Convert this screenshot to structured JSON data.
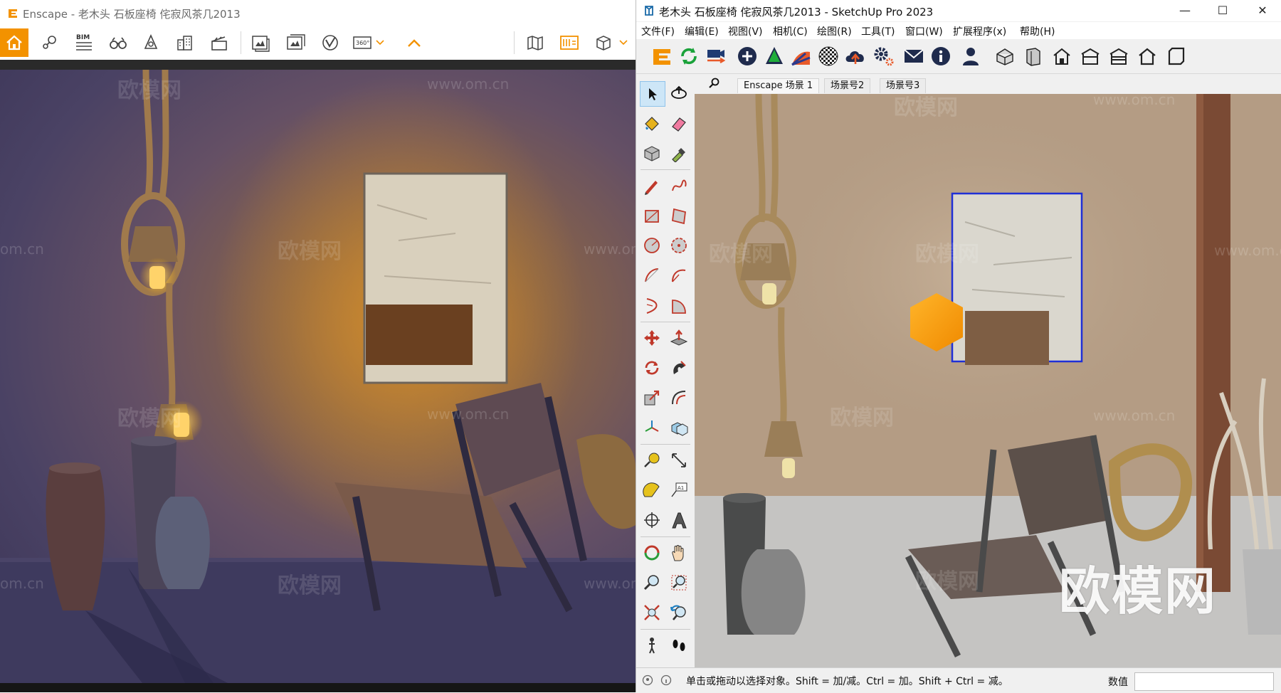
{
  "enscape": {
    "title": "Enscape - 老木头 石板座椅 侘寂风茶几2013",
    "toolbar": {
      "bim_label": "BIM",
      "icons": [
        "home-icon",
        "location-pin-icon",
        "bim-icon",
        "binoculars-icon",
        "light-icon",
        "buildings-icon",
        "clapper-icon",
        "batch-render-icon",
        "gallery-icon",
        "vr-icon",
        "panorama-360-icon",
        "chevron-down-icon",
        "chevron-up-icon",
        "map-icon",
        "asset-library-icon",
        "cube-view-icon"
      ],
      "panorama_label": "360°"
    },
    "accent": "#f39200"
  },
  "sketchup": {
    "title": "老木头 石板座椅 侘寂风茶几2013 - SketchUp Pro 2023",
    "menu": [
      "文件(F)",
      "编辑(E)",
      "视图(V)",
      "相机(C)",
      "绘图(R)",
      "工具(T)",
      "窗口(W)",
      "扩展程序(x)",
      "帮助(H)"
    ],
    "scene_tabs": [
      "Enscape 场景 1",
      "场景号2",
      "场景号3"
    ],
    "status_hint": "单击或拖动以选择对象。Shift = 加/减。Ctrl = 加。Shift + Ctrl = 减。",
    "value_label": "数值",
    "value": "",
    "selection_color": "#1f2fd6"
  },
  "watermarks": {
    "site": "www.om.cn",
    "brand": "欧模网",
    "partial": "om.cn",
    "big": "欧模网"
  }
}
